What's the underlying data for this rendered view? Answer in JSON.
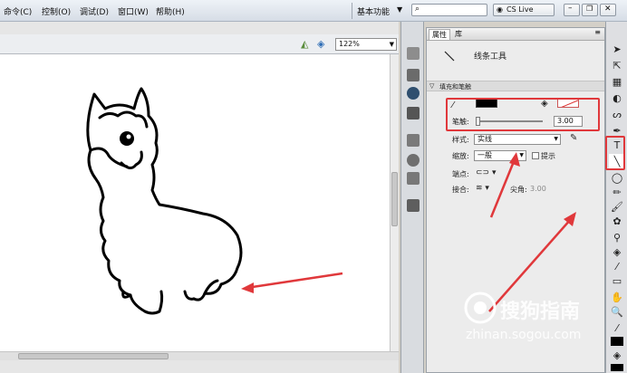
{
  "menu": {
    "items": [
      "命令(C)",
      "控制(O)",
      "调试(D)",
      "窗口(W)",
      "帮助(H)"
    ],
    "workspace": "基本功能",
    "search_placeholder": "",
    "cs_live": "CS Live"
  },
  "stage": {
    "zoom": "122%"
  },
  "properties": {
    "tab_properties": "属性",
    "tab_library": "库",
    "tool_name": "线条工具",
    "section_fill_stroke": "填充和笔触",
    "stroke_label": "笔触:",
    "stroke_value": "3.00",
    "style_label": "样式:",
    "style_value": "实线",
    "scale_label": "缩放:",
    "scale_value": "一般",
    "hint_label": "提示",
    "cap_label": "端点:",
    "join_label": "接合:",
    "miter_label": "尖角:",
    "miter_value": "3.00"
  },
  "watermark": {
    "brand": "搜狗指南",
    "url": "zhinan.sogou.com"
  },
  "colors": {
    "annotation_red": "#e0383b",
    "stroke_swatch": "#000000",
    "fill_swatch": "#ffffff"
  }
}
